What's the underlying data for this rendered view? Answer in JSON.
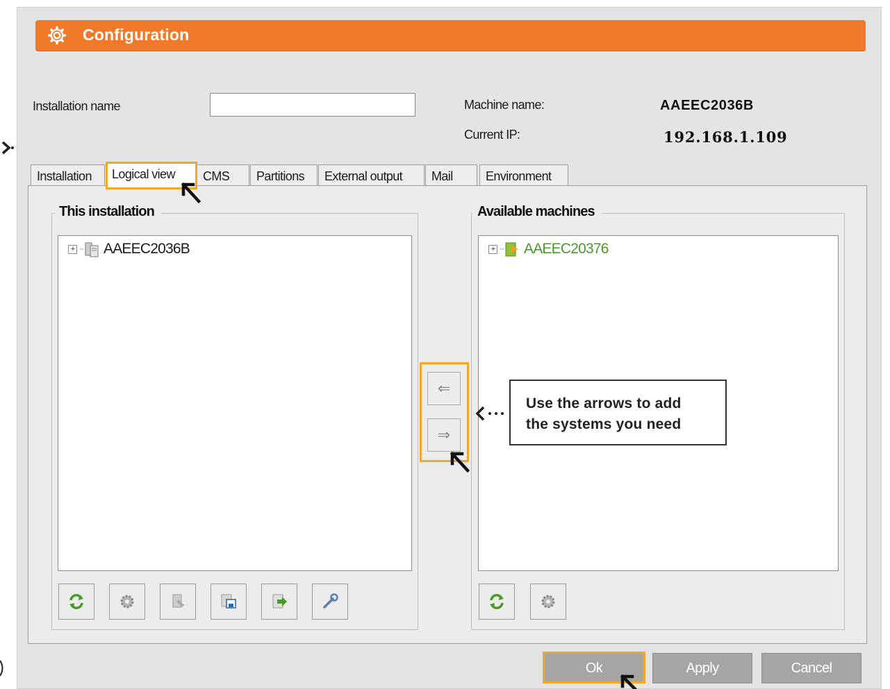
{
  "window": {
    "title": "Configuration",
    "title_icon": "gear-icon",
    "accent_color": "#f07a2a"
  },
  "form": {
    "installation_name_label": "Installation name",
    "installation_name_value": "",
    "machine_name_label": "Machine name:",
    "machine_name_value": "AAEEC2036B",
    "current_ip_label": "Current IP:",
    "current_ip_value": "192.168.1.109"
  },
  "tabs": [
    {
      "label": "Installation"
    },
    {
      "label": "Logical view",
      "active": true
    },
    {
      "label": "CMS"
    },
    {
      "label": "Partitions"
    },
    {
      "label": "External output"
    },
    {
      "label": "Mail"
    },
    {
      "label": "Environment"
    }
  ],
  "this_installation": {
    "title": "This installation",
    "tree": [
      {
        "label": "AAEEC2036B",
        "icon": "server-icon"
      }
    ],
    "toolbar": [
      "refresh-icon",
      "settings-icon",
      "edit-icon",
      "save-icon",
      "export-icon",
      "wrench-icon"
    ]
  },
  "available_machines": {
    "title": "Available machines",
    "tree": [
      {
        "label": "AAEEC20376",
        "icon": "machine-icon",
        "color": "#4a9a2a"
      }
    ],
    "toolbar": [
      "refresh-icon",
      "settings-icon"
    ]
  },
  "transfer": {
    "left_arrow": "⇐",
    "right_arrow": "⇒"
  },
  "callout": {
    "line1": "Use the arrows to add",
    "line2": "the systems you need"
  },
  "footer": {
    "ok": "Ok",
    "apply": "Apply",
    "cancel": "Cancel"
  }
}
